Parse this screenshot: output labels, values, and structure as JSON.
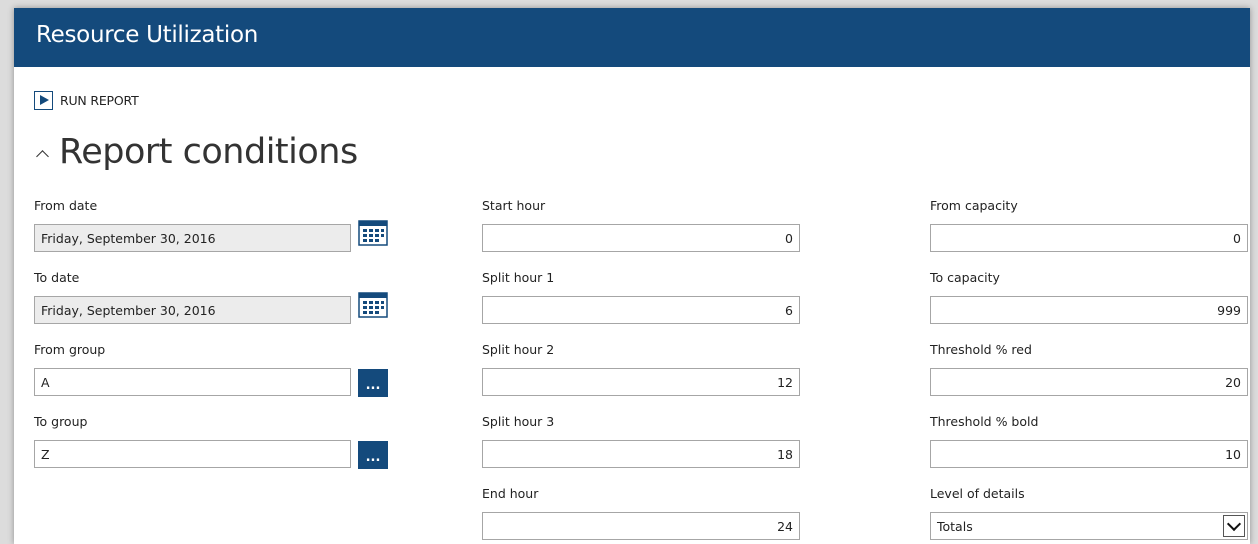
{
  "window": {
    "title": "Resource Utilization"
  },
  "toolbar": {
    "run_report_label": "RUN REPORT"
  },
  "section": {
    "title": "Report conditions"
  },
  "fields": {
    "from_date": {
      "label": "From date",
      "value": "Friday, September 30, 2016"
    },
    "to_date": {
      "label": "To date",
      "value": "Friday, September 30, 2016"
    },
    "from_group": {
      "label": "From group",
      "value": "A"
    },
    "to_group": {
      "label": "To group",
      "value": "Z"
    },
    "start_hour": {
      "label": "Start hour",
      "value": "0"
    },
    "split_hour_1": {
      "label": "Split hour 1",
      "value": "6"
    },
    "split_hour_2": {
      "label": "Split hour 2",
      "value": "12"
    },
    "split_hour_3": {
      "label": "Split hour 3",
      "value": "18"
    },
    "end_hour": {
      "label": "End hour",
      "value": "24"
    },
    "from_capacity": {
      "label": "From capacity",
      "value": "0"
    },
    "to_capacity": {
      "label": "To capacity",
      "value": "999"
    },
    "threshold_red": {
      "label": "Threshold % red",
      "value": "20"
    },
    "threshold_bold": {
      "label": "Threshold % bold",
      "value": "10"
    },
    "level_of_details": {
      "label": "Level of details",
      "value": "Totals"
    }
  },
  "buttons": {
    "lookup_label": "..."
  },
  "icons": {
    "calendar": "calendar-icon",
    "play": "play-icon",
    "chevron_up": "chevron-up-icon",
    "dropdown": "chevron-down-icon"
  },
  "colors": {
    "header": "#144a7c",
    "accent": "#144a7c",
    "readonly_bg": "#ececec"
  }
}
